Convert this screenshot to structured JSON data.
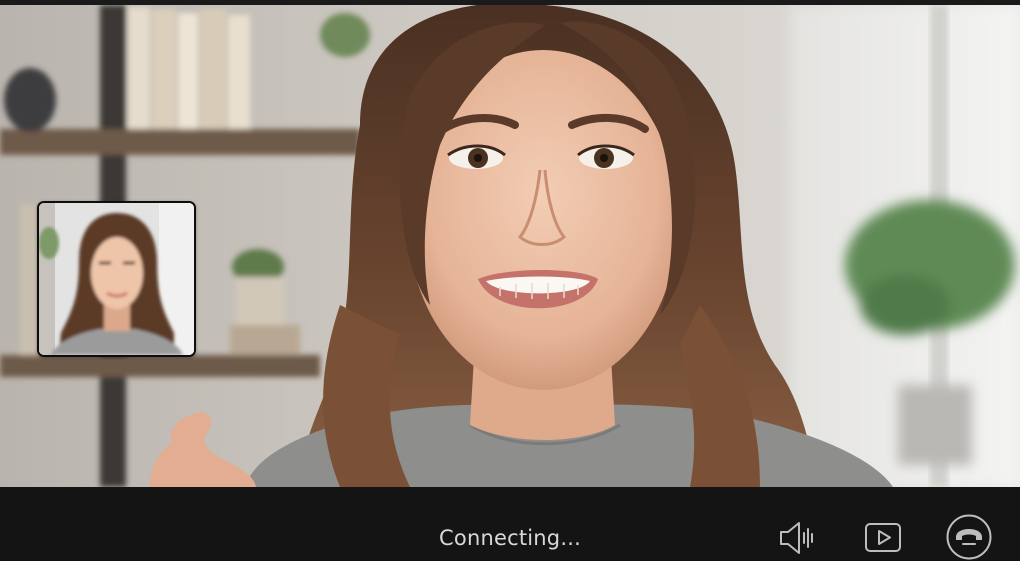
{
  "call": {
    "status_text": "Connecting..."
  },
  "controls": {
    "mute_icon": "speaker-icon",
    "video_icon": "play-video-icon",
    "end_call_icon": "phone-hangup-icon"
  },
  "colors": {
    "control_bar": "#141414",
    "icon_stroke": "#bdbdbd",
    "status_text": "#d8d8d8"
  }
}
